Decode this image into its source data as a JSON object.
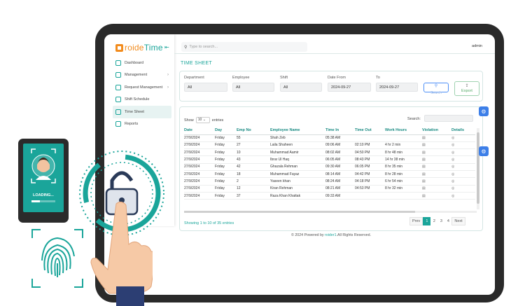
{
  "brand": {
    "logo_text_left": "roide",
    "logo_text_right": "Time"
  },
  "sidebar": {
    "items": [
      {
        "label": "Dashboard",
        "chevron": false,
        "active": false
      },
      {
        "label": "Management",
        "chevron": true,
        "active": false
      },
      {
        "label": "Request Management",
        "chevron": true,
        "active": false
      },
      {
        "label": "Shift Schedule",
        "chevron": false,
        "active": false
      },
      {
        "label": "Time Sheet",
        "chevron": false,
        "active": true
      },
      {
        "label": "Reports",
        "chevron": false,
        "active": false
      }
    ]
  },
  "header": {
    "search_placeholder": "Type to search...",
    "user": "admin"
  },
  "page": {
    "title": "TIME SHEET"
  },
  "filters": {
    "department": {
      "label": "Department",
      "value": "All"
    },
    "employee": {
      "label": "Employee",
      "value": "All"
    },
    "shift": {
      "label": "Shift",
      "value": "All"
    },
    "date_from": {
      "label": "Date From",
      "value": "2024-09-27"
    },
    "date_to": {
      "label": "To",
      "value": "2024-09-27"
    },
    "search_label": "Search",
    "export_label": "Export"
  },
  "table": {
    "show_label": "Show",
    "show_value": "10",
    "entries_label": "entries",
    "search_label": "Search:",
    "columns": [
      "Date",
      "Day",
      "Emp No",
      "Employee Name",
      "Time In",
      "Time Out",
      "Work Hours",
      "Violation",
      "Details"
    ],
    "rows": [
      [
        "27/9/2024",
        "Friday",
        "55",
        "Shah Zeb",
        "05:38 AM",
        "",
        "",
        "",
        ""
      ],
      [
        "27/9/2024",
        "Friday",
        "27",
        "Laila Shaheen",
        "09:06 AM",
        "02:10 PM",
        "4 hr 2 min",
        "",
        ""
      ],
      [
        "27/9/2024",
        "Friday",
        "10",
        "Muhammad Aamir",
        "08:02 AM",
        "04:50 PM",
        "8 hr 48 min",
        "",
        ""
      ],
      [
        "27/9/2024",
        "Friday",
        "43",
        "Ibrar Ul Haq",
        "06:05 AM",
        "08:43 PM",
        "14 hr 38 min",
        "",
        ""
      ],
      [
        "27/9/2024",
        "Friday",
        "42",
        "Ghazala Rehman",
        "09:30 AM",
        "06:05 PM",
        "8 hr 35 min",
        "",
        ""
      ],
      [
        "27/9/2024",
        "Friday",
        "18",
        "Muhammad Fayaz",
        "08:14 AM",
        "04:42 PM",
        "8 hr 28 min",
        "",
        ""
      ],
      [
        "27/9/2024",
        "Friday",
        "2",
        "Yaseen khan",
        "08:24 AM",
        "04:18 PM",
        "6 hr 54 min",
        "",
        ""
      ],
      [
        "27/9/2024",
        "Friday",
        "12",
        "Kiran Rehman",
        "08:21 AM",
        "04:53 PM",
        "8 hr 32 min",
        "",
        ""
      ],
      [
        "27/9/2024",
        "Friday",
        "37",
        "Raza Khan Khattak",
        "09:33 AM",
        "",
        "",
        "",
        ""
      ]
    ],
    "info": "Showing 1 to 10 of 35 entries",
    "pagination": [
      "Prev",
      "1",
      "2",
      "3",
      "4",
      "Next"
    ]
  },
  "footer": {
    "text": "© 2024 Powered by ",
    "brand": "roider1",
    "suffix": ".All Rights Reserved."
  },
  "phone": {
    "loading_text": "LOADING..."
  },
  "colors": {
    "accent": "#1aa59a",
    "logo_orange": "#f28c1e",
    "button_blue": "#4d8ff7",
    "frame": "#2a2a2a"
  }
}
